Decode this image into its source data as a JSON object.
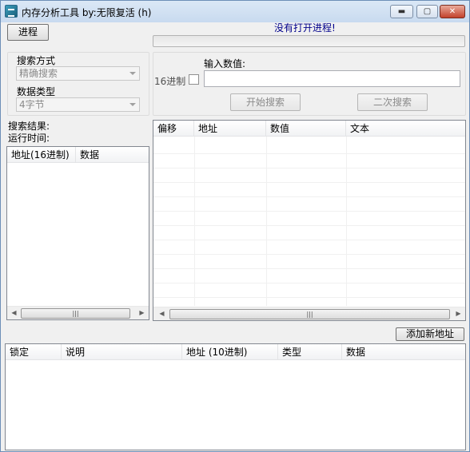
{
  "window": {
    "title": "内存分析工具    by:无限复活   (h)",
    "min_glyph": "▬",
    "max_glyph": "▢",
    "close_glyph": "✕"
  },
  "toolbar": {
    "process_button": "进程",
    "status_text": "没有打开进程!",
    "status_color": "#00008b"
  },
  "search": {
    "mode_label": "搜索方式",
    "mode_value": "精确搜索",
    "type_label": "数据类型",
    "type_value": "4字节",
    "hex_label": "16进制",
    "input_label": "输入数值:",
    "input_value": "",
    "start_button": "开始搜索",
    "second_button": "二次搜索"
  },
  "results": {
    "result_label": "搜索结果:",
    "time_label": "运行时间:",
    "columns": [
      "地址(16进制)",
      "数据"
    ]
  },
  "memory_view": {
    "columns": [
      "偏移",
      "地址",
      "数值",
      "文本"
    ]
  },
  "saved": {
    "add_button": "添加新地址",
    "columns": [
      "锁定",
      "说明",
      "地址 (10进制)",
      "类型",
      "数据"
    ]
  },
  "scrollbar": {
    "left_arrow": "◀",
    "right_arrow": "▶",
    "grip": "|||"
  }
}
